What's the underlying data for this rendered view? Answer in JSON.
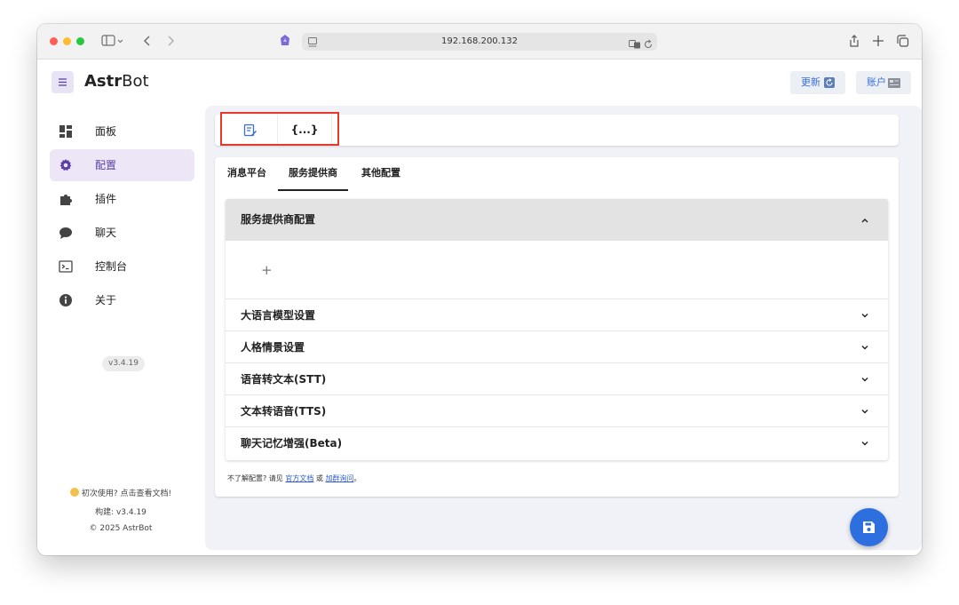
{
  "browser": {
    "url": "192.168.200.132"
  },
  "app": {
    "brand_bold": "Astr",
    "brand_rest": "Bot",
    "update_label": "更新",
    "account_label": "账户"
  },
  "sidebar": {
    "items": [
      {
        "label": "面板",
        "icon": "dashboard-icon"
      },
      {
        "label": "配置",
        "icon": "gear-icon"
      },
      {
        "label": "插件",
        "icon": "puzzle-icon"
      },
      {
        "label": "聊天",
        "icon": "chat-icon"
      },
      {
        "label": "控制台",
        "icon": "console-icon"
      },
      {
        "label": "关于",
        "icon": "info-icon"
      }
    ],
    "active_index": 1,
    "version_chip": "v3.4.19",
    "footer": {
      "first_use": "初次使用? 点击查看文档!",
      "build": "构建: v3.4.19",
      "copyright": "© 2025 AstrBot"
    }
  },
  "editor_switch": {
    "visual_icon": "edit-form-icon",
    "code_label": "{...}"
  },
  "config": {
    "tabs": [
      "消息平台",
      "服务提供商",
      "其他配置"
    ],
    "active_tab": 1,
    "panel_title": "服务提供商配置",
    "add_label": "+",
    "sections": [
      "大语言模型设置",
      "人格情景设置",
      "语音转文本(STT)",
      "文本转语音(TTS)",
      "聊天记忆增强(Beta)"
    ],
    "hint_prefix": "不了解配置? 请见",
    "hint_link1": "官方文档",
    "hint_mid": "或",
    "hint_link2": "加群询问",
    "hint_suffix": "。"
  },
  "colors": {
    "accent": "#5b3ea6",
    "active_nav_bg": "#ece6f6",
    "fab": "#2e6fe0",
    "highlight_box": "#e5392e"
  }
}
